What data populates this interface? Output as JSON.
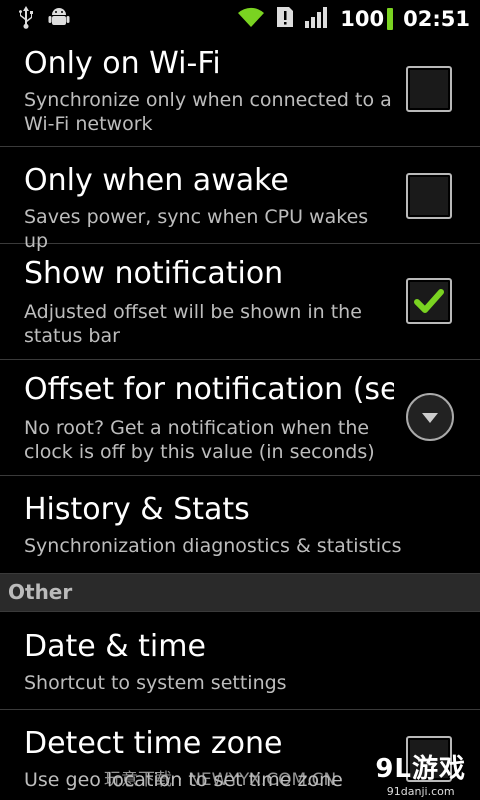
{
  "statusbar": {
    "battery": "100",
    "time": "02:51",
    "colors": {
      "battery_accent": "#7ad321"
    },
    "icons": [
      "usb-icon",
      "android-debug-icon",
      "wifi-icon",
      "alert-icon",
      "signal-icon",
      "battery-icon"
    ]
  },
  "settings": {
    "only_wifi": {
      "title": "Only on Wi-Fi",
      "summary": "Synchronize only when connected to a Wi-Fi network",
      "checked": false
    },
    "only_awake": {
      "title": "Only when awake",
      "summary": "Saves power, sync when CPU wakes up",
      "checked": false
    },
    "show_notification": {
      "title": "Show notification",
      "summary": "Adjusted offset will be shown in the status bar",
      "checked": true
    },
    "offset_notification": {
      "title": "Offset for notification (se",
      "summary": "No root? Get a notification when the clock is off by this value (in seconds)"
    },
    "history": {
      "title": "History & Stats",
      "summary": "Synchronization diagnostics & statistics"
    }
  },
  "section_other": {
    "label": "Other"
  },
  "other": {
    "date_time": {
      "title": "Date & time",
      "summary": "Shortcut to system settings"
    },
    "detect_tz": {
      "title": "Detect time zone",
      "summary": "Use geo location to set time zone"
    }
  },
  "watermark": {
    "text": "玩意下载 · NEWYYX.COM.CN",
    "logo": "9L游戏",
    "logo_url": "91danji.com"
  },
  "colors": {
    "check_accent": "#7ad321",
    "background": "#000000",
    "section_bg": "#2a2a2a"
  }
}
